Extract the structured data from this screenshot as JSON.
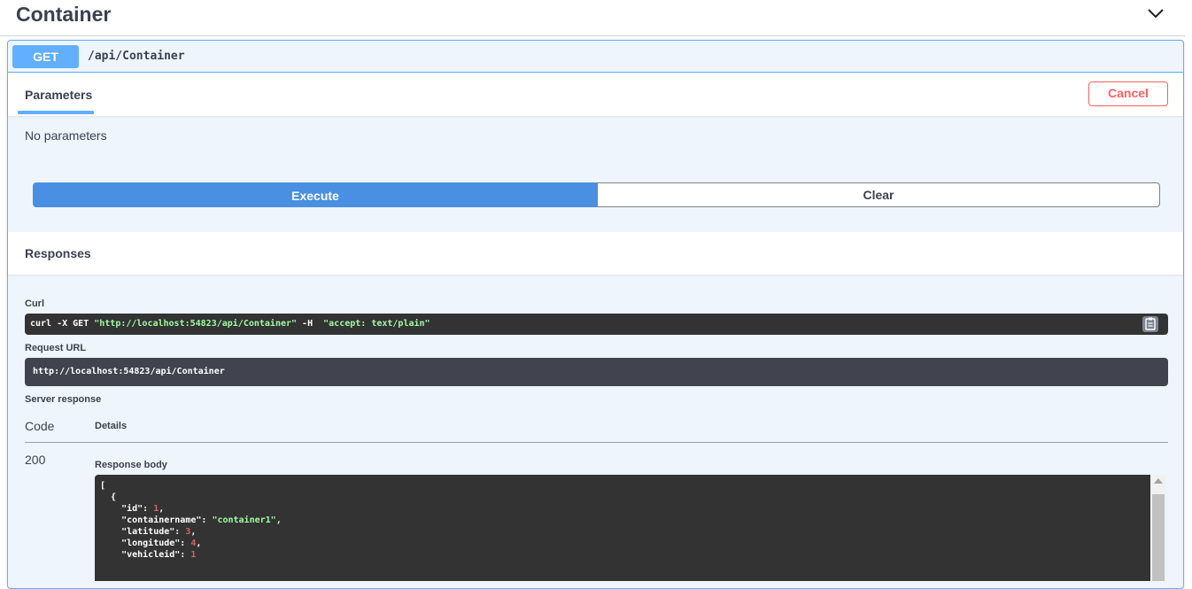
{
  "tag": {
    "title": "Container",
    "chevron_icon": "chevron-down-icon"
  },
  "operation": {
    "method": "GET",
    "path": "/api/Container"
  },
  "parameters": {
    "tab_label": "Parameters",
    "cancel_label": "Cancel",
    "empty_text": "No parameters"
  },
  "actions": {
    "execute_label": "Execute",
    "clear_label": "Clear"
  },
  "responses": {
    "label": "Responses",
    "curl_label": "Curl",
    "curl_parts": {
      "cmd": "curl -X GET ",
      "url": "\"http://localhost:54823/api/Container\"",
      "flag": " -H  ",
      "header": "\"accept: text/plain\""
    },
    "copy_icon": "clipboard-icon",
    "request_url_label": "Request URL",
    "request_url": "http://localhost:54823/api/Container",
    "server_response_label": "Server response",
    "code_header": "Code",
    "details_header": "Details",
    "status_code": "200",
    "response_body_label": "Response body",
    "body": {
      "open_bracket": "[",
      "open_brace": "  {",
      "fields": [
        {
          "key": "\"id\"",
          "value": "1",
          "kind": "num",
          "sep": ","
        },
        {
          "key": "\"containername\"",
          "value": "\"container1\"",
          "kind": "str",
          "sep": ","
        },
        {
          "key": "\"latitude\"",
          "value": "3",
          "kind": "num",
          "sep": ","
        },
        {
          "key": "\"longitude\"",
          "value": "4",
          "kind": "num",
          "sep": ","
        },
        {
          "key": "\"vehicleid\"",
          "value": "1",
          "kind": "num",
          "sep": ""
        }
      ]
    }
  },
  "colors": {
    "get_accent": "#61affe",
    "execute": "#4990e2",
    "cancel": "#ff6060",
    "code_bg": "#333333",
    "json_number": "#d36363",
    "json_string": "#a2fca2"
  }
}
